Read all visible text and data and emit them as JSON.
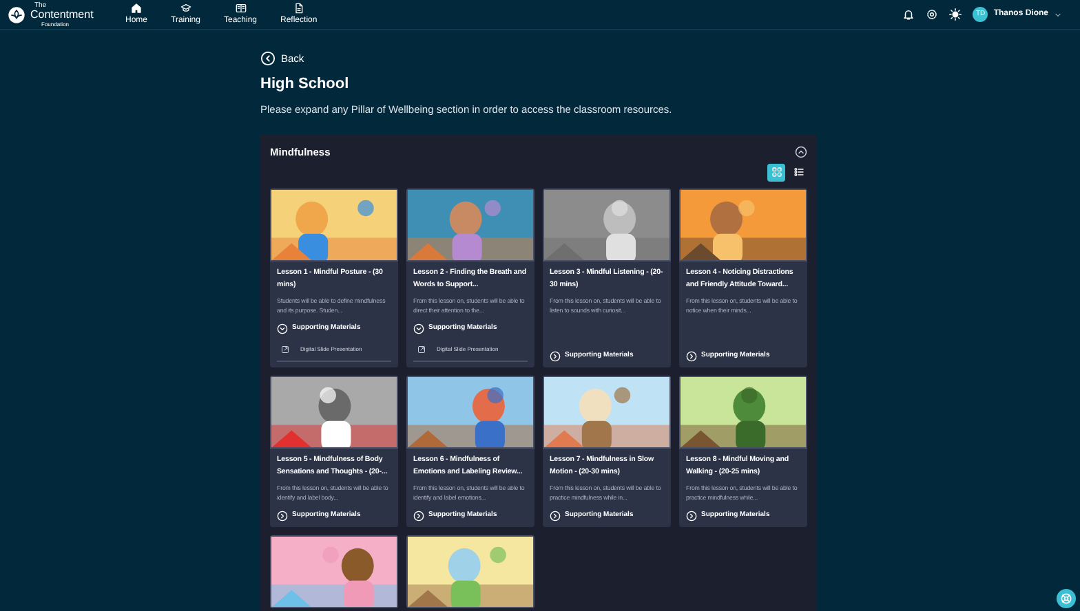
{
  "header": {
    "logo": {
      "line_1": "The",
      "line_2": "Contentment",
      "line_3": "Foundation"
    },
    "nav": [
      {
        "label": "Home"
      },
      {
        "label": "Training"
      },
      {
        "label": "Teaching"
      },
      {
        "label": "Reflection"
      }
    ],
    "user": {
      "initials": "TD",
      "name": "Thanos Dione"
    }
  },
  "back": "Back",
  "title": "High School",
  "intro": "Please expand any Pillar of Wellbeing section in order to access the classroom resources.",
  "section": {
    "title": "Mindfulness",
    "expanded": true,
    "view_buttons": [
      {
        "selected": true
      },
      {
        "selected": false
      }
    ],
    "lessons": [
      {
        "kind": "lesson",
        "title": "Lesson 1 - Mindful Posture - (30 mins)",
        "description": "Students will be able to define mindfulness and its purpose. Studen...",
        "materials_label": "Supporting Materials",
        "expanded": true,
        "materials": [
          "Digital Slide Presentation"
        ]
      },
      {
        "kind": "lesson",
        "title": "Lesson 2 - Finding the Breath and Words to Support...",
        "description": "From this lesson on, students will be able to direct their attention to the...",
        "materials_label": "Supporting Materials",
        "expanded": true,
        "materials": [
          "Digital Slide Presentation"
        ]
      },
      {
        "kind": "lesson",
        "title": "Lesson 3 - Mindful Listening - (20-30 mins)",
        "description": "From this lesson on, students will be able to listen to sounds with curiosit...",
        "materials_label": "Supporting Materials",
        "expanded": false
      },
      {
        "kind": "lesson",
        "title": "Lesson 4 - Noticing Distractions and Friendly Attitude Toward...",
        "description": "From this lesson on, students will be able to notice when their minds...",
        "materials_label": "Supporting Materials",
        "expanded": false
      },
      {
        "kind": "lesson",
        "title": "Lesson 5 - Mindfulness of Body Sensations and Thoughts - (20-...",
        "description": "From this lesson on, students will be able to identify and label body...",
        "materials_label": "Supporting Materials",
        "expanded": false
      },
      {
        "kind": "lesson",
        "title": "Lesson 6 - Mindfulness of Emotions and Labeling Review...",
        "description": "From this lesson on, students will be able to identify and label emotions...",
        "materials_label": "Supporting Materials",
        "expanded": false
      },
      {
        "kind": "lesson",
        "title": "Lesson 7 - Mindfulness in Slow Motion - (20-30 mins)",
        "description": "From this lesson on, students will be able to practice mindfulness while in...",
        "materials_label": "Supporting Materials",
        "expanded": false
      },
      {
        "kind": "lesson",
        "title": "Lesson 8 - Mindful Moving and Walking - (20-25 mins)",
        "description": "From this lesson on, students will be able to practice mindfulness while...",
        "materials_label": "Supporting Materials",
        "expanded": false
      },
      {
        "kind": "picture"
      },
      {
        "kind": "picture"
      }
    ]
  }
}
